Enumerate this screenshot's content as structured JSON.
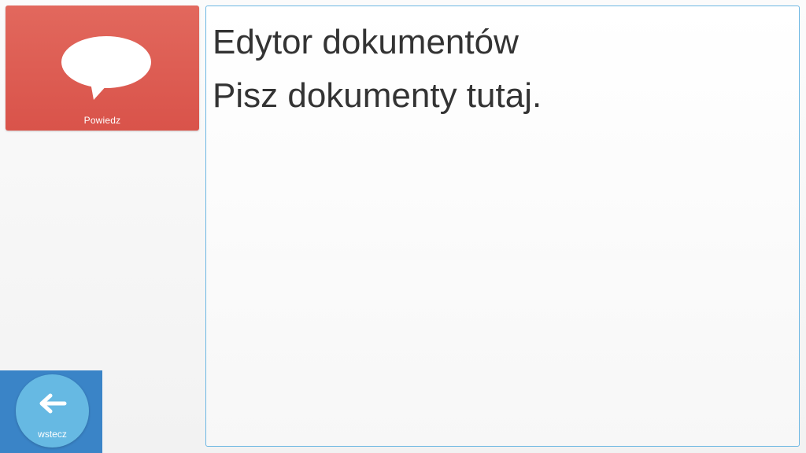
{
  "speak_tile": {
    "label": "Powiedz",
    "icon": "speech-bubble-icon",
    "color": "#dd5b51"
  },
  "editor": {
    "lines": [
      "Edytor dokumentów",
      "Pisz dokumenty tutaj."
    ],
    "border_color": "#6cb7e3"
  },
  "back": {
    "label": "wstecz",
    "icon": "arrow-left-icon",
    "color": "#66b9e3",
    "panel_color": "#3a84c7"
  }
}
